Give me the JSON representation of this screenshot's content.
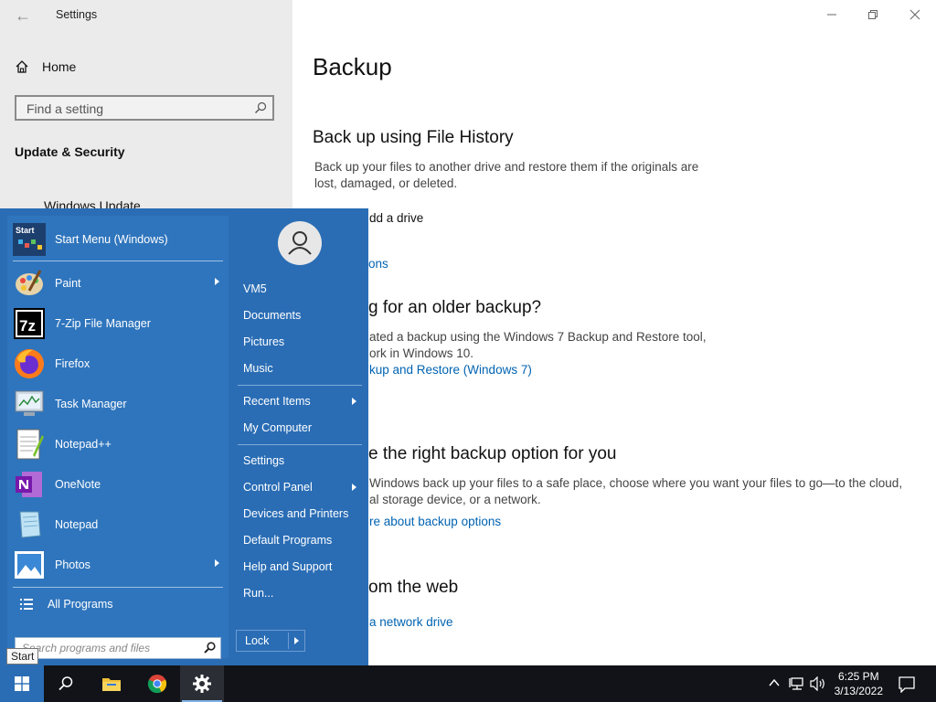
{
  "window": {
    "title": "Settings",
    "home_label": "Home",
    "search_placeholder": "Find a setting",
    "section": "Update & Security",
    "nav_partial": "Windows Update"
  },
  "content": {
    "page_title": "Backup",
    "file_history_heading": "Back up using File History",
    "file_history_desc_1": "Back up your files to another drive and restore them if the originals are",
    "file_history_desc_2": "lost, damaged, or deleted.",
    "add_drive_partial": "dd a drive",
    "more_options_partial": "ions",
    "older_backup_heading_partial": "g for an older backup?",
    "older_desc_1_partial": "ated a backup using the Windows 7 Backup and Restore tool,",
    "older_desc_2_partial": "ork in Windows 10.",
    "backup_restore_link_partial": "kup and Restore (Windows 7)",
    "right_option_heading_partial": "e the right backup option for you",
    "right_desc_1_partial": "Windows back up your files to a safe place, choose where you want your files to go—to the cloud,",
    "right_desc_2_partial": "al storage device, or a network.",
    "learn_more_partial": "re about backup options",
    "web_heading_partial": "om the web",
    "network_drive_partial": "a network drive"
  },
  "start_menu": {
    "pinned_label": "Start Menu (Windows)",
    "pinned_icon_text": "Start",
    "apps": [
      {
        "label": "Paint",
        "submenu": true
      },
      {
        "label": "7-Zip File Manager",
        "submenu": false
      },
      {
        "label": "Firefox",
        "submenu": false
      },
      {
        "label": "Task Manager",
        "submenu": false
      },
      {
        "label": "Notepad++",
        "submenu": false
      },
      {
        "label": "OneNote",
        "submenu": false
      },
      {
        "label": "Notepad",
        "submenu": false
      },
      {
        "label": "Photos",
        "submenu": true
      }
    ],
    "all_programs": "All Programs",
    "search_placeholder": "Search programs and files",
    "right": {
      "user": "VM5",
      "documents": "Documents",
      "pictures": "Pictures",
      "music": "Music",
      "recent_items": "Recent Items",
      "my_computer": "My Computer",
      "settings": "Settings",
      "control_panel": "Control Panel",
      "devices_printers": "Devices and Printers",
      "default_programs": "Default Programs",
      "help_support": "Help and Support",
      "run": "Run..."
    },
    "lock": "Lock",
    "seven_zip_icon_text": "7z"
  },
  "tooltip": "Start",
  "taskbar": {
    "time": "6:25 PM",
    "date": "3/13/2022"
  },
  "colors": {
    "start_menu_bg": "#2a6db5",
    "link": "#0063b1",
    "taskbar": "#111318"
  }
}
